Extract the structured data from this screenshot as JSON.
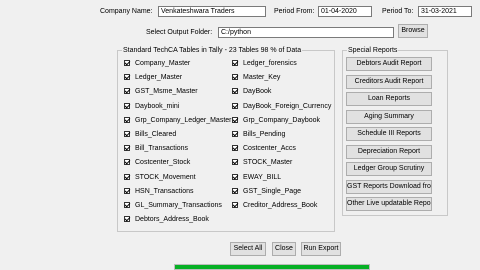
{
  "header": {
    "company_label": "Company Name:",
    "company_value": "Venkateshwara Traders",
    "period_from_label": "Period From:",
    "period_from_value": "01-04-2020",
    "period_to_label": "Period To:",
    "period_to_value": "31-03-2021",
    "output_folder_label": "Select Output Folder:",
    "output_folder_value": "C:/python",
    "browse_label": "Browse"
  },
  "tables_group": {
    "title": "Standard TechCA Tables in Tally - 23 Tables 98 % of Data",
    "left_column": [
      {
        "label": "Company_Master",
        "checked": true
      },
      {
        "label": "Ledger_Master",
        "checked": true
      },
      {
        "label": "GST_Msme_Master",
        "checked": true
      },
      {
        "label": "Daybook_mini",
        "checked": true
      },
      {
        "label": "Grp_Company_Ledger_Master",
        "checked": true
      },
      {
        "label": "Bills_Cleared",
        "checked": true
      },
      {
        "label": "Bill_Transactions",
        "checked": true
      },
      {
        "label": "Costcenter_Stock",
        "checked": true
      },
      {
        "label": "STOCK_Movement",
        "checked": true
      },
      {
        "label": "HSN_Transactions",
        "checked": true
      },
      {
        "label": "GL_Summary_Transactions",
        "checked": true
      },
      {
        "label": "Debtors_Address_Book",
        "checked": true
      }
    ],
    "right_column": [
      {
        "label": "Ledger_forensics",
        "checked": true
      },
      {
        "label": "Master_Key",
        "checked": true
      },
      {
        "label": "DayBook",
        "checked": true
      },
      {
        "label": "DayBook_Foreign_Currency",
        "checked": true
      },
      {
        "label": "Grp_Company_Daybook",
        "checked": true
      },
      {
        "label": "Bills_Pending",
        "checked": true
      },
      {
        "label": "Costcenter_Accs",
        "checked": true
      },
      {
        "label": "STOCK_Master",
        "checked": true
      },
      {
        "label": "EWAY_BILL",
        "checked": true
      },
      {
        "label": "GST_Single_Page",
        "checked": true
      },
      {
        "label": "Creditor_Address_Book",
        "checked": true
      }
    ]
  },
  "special_reports": {
    "title": "Special Reports",
    "buttons": [
      "Debtors Audit Report",
      "Creditors Audit Report",
      "Loan Reports",
      "Aging Summary",
      "Schedule III Reports",
      "Depreciation Report",
      "Ledger Group Scrutiny",
      "GST Reports Download from Site",
      "Other Live updatable Reports"
    ]
  },
  "footer": {
    "select_all_label": "Select All",
    "close_label": "Close",
    "run_export_label": "Run Export"
  },
  "progress": {
    "fraction": 1.0,
    "color": "#06b025"
  }
}
